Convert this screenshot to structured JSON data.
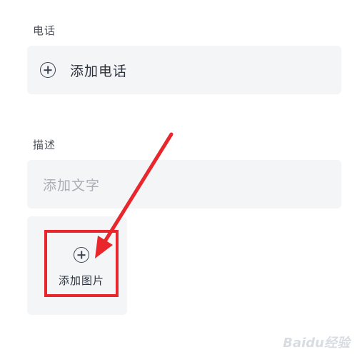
{
  "phone": {
    "section_label": "电话",
    "add_label": "添加电话"
  },
  "description": {
    "section_label": "描述",
    "placeholder": "添加文字"
  },
  "image": {
    "add_label": "添加图片"
  },
  "watermark": {
    "text": "Baidu经验"
  },
  "colors": {
    "card_background": "#f4f5f7",
    "highlight_red": "#e8262b",
    "icon": "#3a4150",
    "placeholder": "#a9adb5"
  }
}
